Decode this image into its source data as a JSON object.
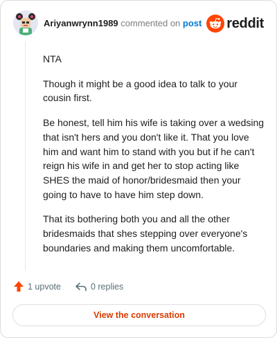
{
  "header": {
    "username": "Ariyanwrynn1989",
    "action_text": "commented on",
    "target_text": "post",
    "avatar_icon": "user-avatar-icon",
    "brand_icon": "reddit-snoo-icon",
    "brand_name": "reddit"
  },
  "comment": {
    "paragraphs": [
      "NTA",
      "Though it might be a good idea to talk to your cousin first.",
      "Be honest, tell him his wife is taking over a wedsing that isn't hers and you don't like it. That you love him and want him to stand with you but if he can't reign his wife in and get her to stop acting like SHES the maid of honor/bridesmaid then your going to have to have him step down.",
      "That its bothering both you and all the other bridesmaids that shes stepping over everyone's boundaries and making them uncomfortable."
    ]
  },
  "actions": {
    "upvote_icon": "upvote-arrow-icon",
    "upvote_label": "1 upvote",
    "reply_icon": "reply-icon",
    "reply_label": "0 replies"
  },
  "cta": {
    "label": "View the conversation"
  },
  "colors": {
    "brand_orange": "#ff4500",
    "link_blue": "#0079d3",
    "cta_text": "#d93a00"
  }
}
